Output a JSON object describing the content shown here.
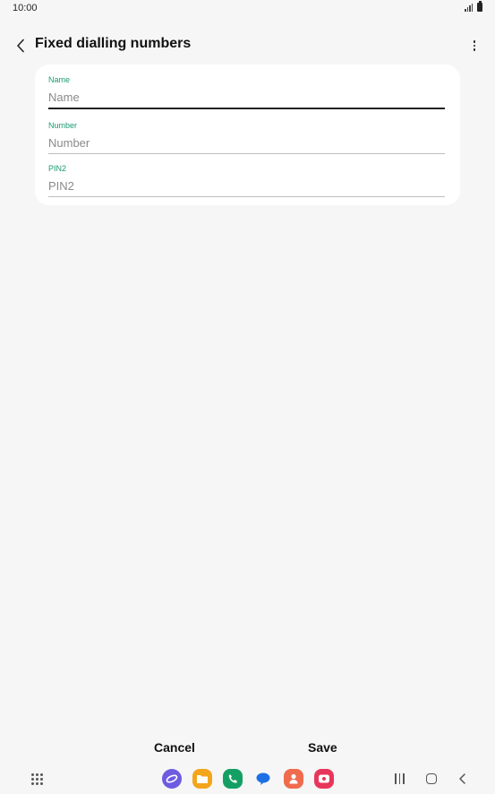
{
  "status_bar": {
    "time": "10:00"
  },
  "header": {
    "title": "Fixed dialling numbers"
  },
  "form": {
    "name": {
      "label": "Name",
      "placeholder": "Name",
      "value": ""
    },
    "number": {
      "label": "Number",
      "placeholder": "Number",
      "value": ""
    },
    "pin2": {
      "label": "PIN2",
      "placeholder": "PIN2",
      "value": ""
    }
  },
  "actions": {
    "cancel_label": "Cancel",
    "save_label": "Save"
  },
  "colors": {
    "accent": "#1a9a74",
    "background": "#f6f6f6",
    "card": "#ffffff"
  },
  "dock_apps": [
    "internet-icon",
    "files-icon",
    "phone-icon",
    "messages-icon",
    "contacts-icon",
    "screen-recorder-icon"
  ]
}
